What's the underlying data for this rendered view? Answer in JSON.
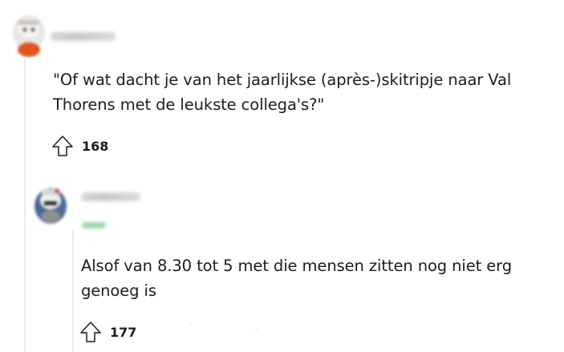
{
  "comments": [
    {
      "username": "",
      "avatar_icon": "snoo-avatar-icon",
      "text": "\"Of wat dacht je van het jaarlijkse (après-)skitripje naar Val Thorens met de leukste collega's?\"",
      "upvote_icon": "arrow-up-outline-icon",
      "votes": "168"
    },
    {
      "username": "",
      "avatar_icon": "snoo-avatar-icon",
      "text": "Alsof van 8.30 tot 5 met die mensen zitten nog niet erg genoeg is",
      "upvote_icon": "arrow-up-outline-icon",
      "votes": "177"
    }
  ],
  "colors": {
    "text": "#1c1c1c",
    "thread_line": "#ebebeb",
    "avatar1_accent": "#e2531d",
    "flair_green": "#9fd9a8"
  }
}
